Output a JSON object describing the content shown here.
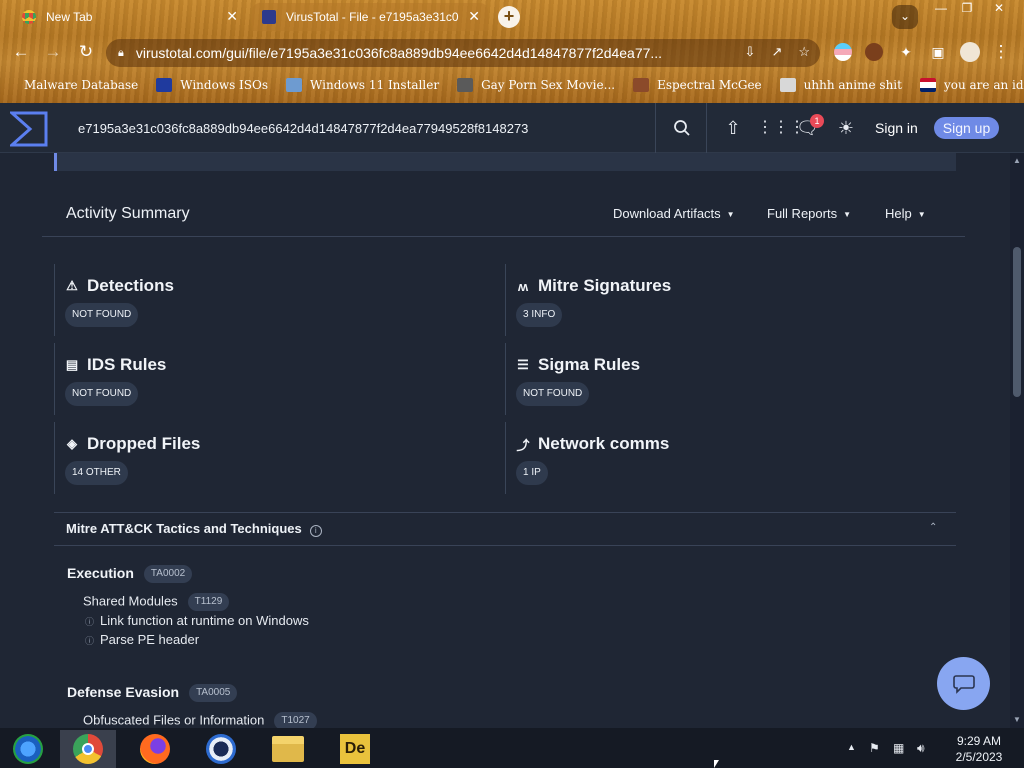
{
  "browser": {
    "tabs": [
      {
        "title": "New Tab",
        "active": false
      },
      {
        "title": "VirusTotal - File - e7195a3e31c0",
        "active": true
      }
    ],
    "url": "virustotal.com/gui/file/e7195a3e31c036fc8a889db94ee6642d4d14847877f2d4ea77...",
    "bookmarks": [
      "Malware Database",
      "Windows ISOs",
      "Windows 11 Installer",
      "Gay Porn Sex Movie...",
      "Espectral McGee",
      "uhhh anime shit",
      "you are an idiot!"
    ]
  },
  "header": {
    "search_value": "e7195a3e31c036fc8a889db94ee6642d4d14847877f2d4ea77949528f8148273",
    "notification_count": "1",
    "signin": "Sign in",
    "signup": "Sign up"
  },
  "activity": {
    "title": "Activity Summary",
    "menus": [
      "Download Artifacts",
      "Full Reports",
      "Help"
    ],
    "cards": [
      {
        "title": "Detections",
        "value": "NOT FOUND"
      },
      {
        "title": "Mitre Signatures",
        "value": "3 INFO"
      },
      {
        "title": "IDS Rules",
        "value": "NOT FOUND"
      },
      {
        "title": "Sigma Rules",
        "value": "NOT FOUND"
      },
      {
        "title": "Dropped Files",
        "value": "14 OTHER"
      },
      {
        "title": "Network comms",
        "value": "1 IP"
      }
    ]
  },
  "mitre": {
    "title": "Mitre ATT&CK Tactics and Techniques",
    "tactics": [
      {
        "name": "Execution",
        "id": "TA0002",
        "technique": "Shared Modules",
        "technique_id": "T1129",
        "items": [
          "Link function at runtime on Windows",
          "Parse PE header"
        ]
      },
      {
        "name": "Defense Evasion",
        "id": "TA0005",
        "technique": "Obfuscated Files or Information",
        "technique_id": "T1027"
      }
    ]
  },
  "taskbar": {
    "time": "9:29 AM",
    "date": "2/5/2023"
  },
  "colors": {
    "accent": "#6f8ae6",
    "background": "#1f2634",
    "fab": "#88a6f1"
  }
}
